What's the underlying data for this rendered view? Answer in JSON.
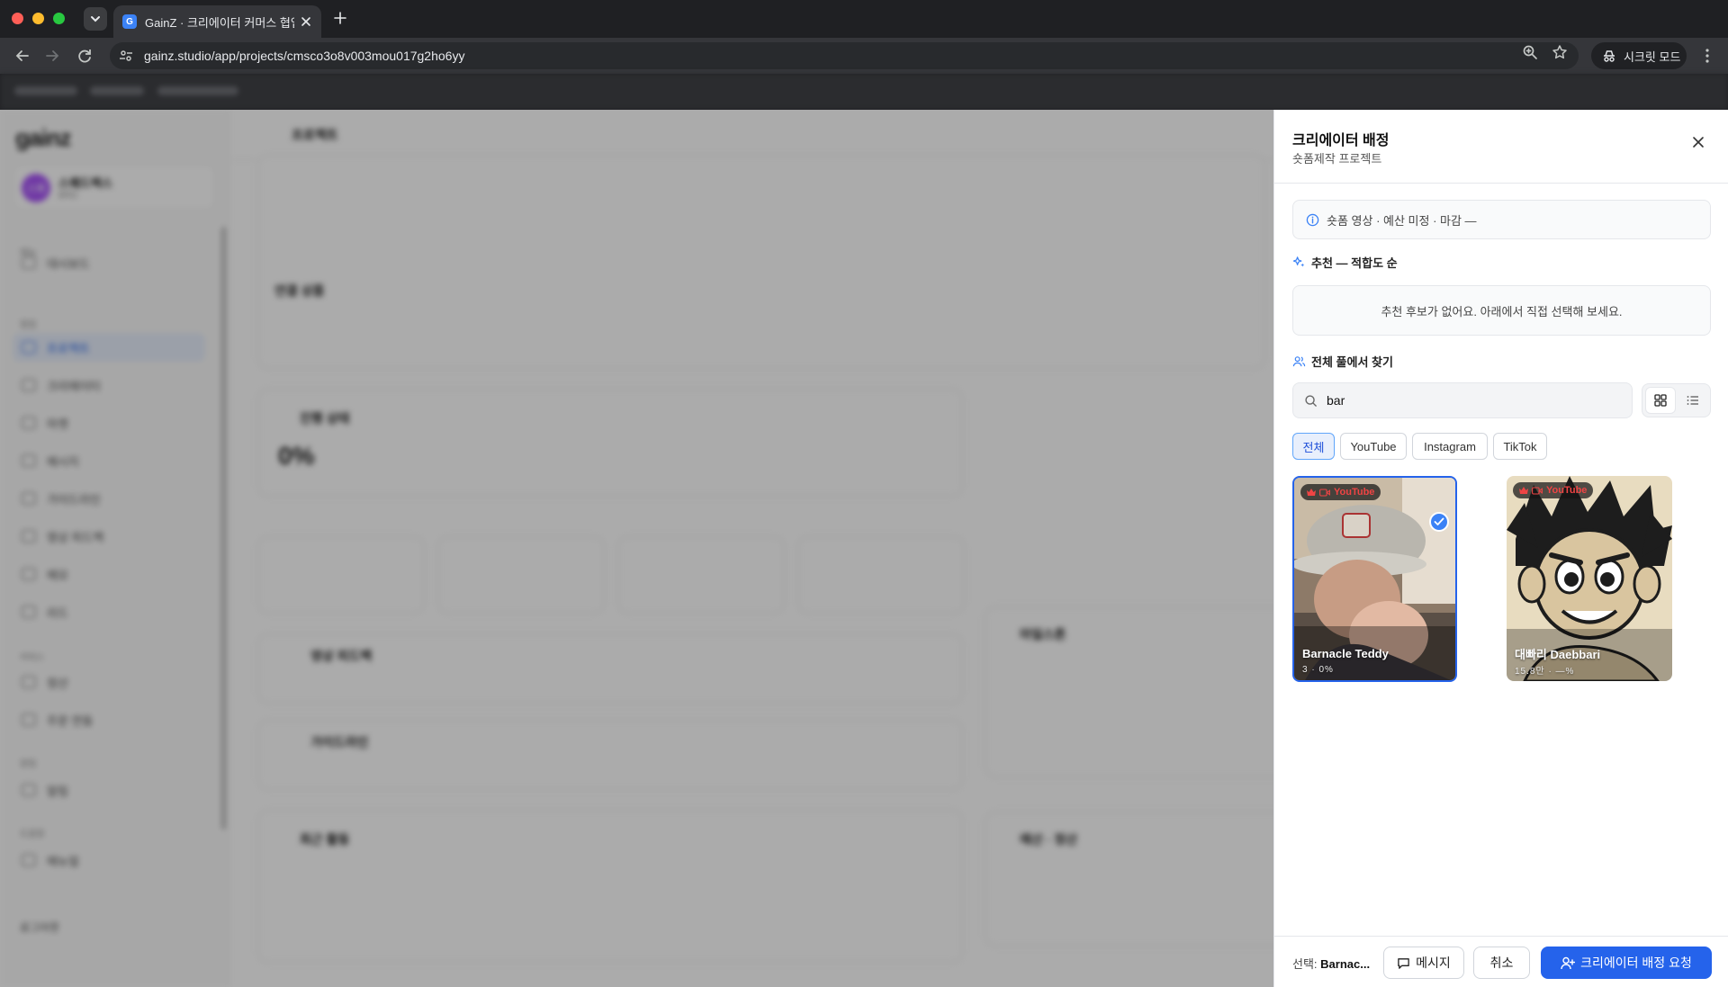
{
  "browser": {
    "tab_title": "GainZ · 크리에이터 커머스 협업 C",
    "favicon_letter": "G",
    "url": "gainz.studio/app/projects/cmsco3o8v003mou017g2ho6yy",
    "incognito_label": "시크릿 모드"
  },
  "app_bg": {
    "logo": "gainz",
    "workspace_initials": "스퀘",
    "workspace_name": "스퀘드렉스",
    "workspace_sub": "BRD",
    "topbar_title": "프로젝트",
    "sidebar_sections": [
      "메뉴",
      "협업",
      "커머스",
      "알림",
      "도움말"
    ],
    "sidebar_items": [
      "대시보드",
      "프로젝트",
      "크리에이터",
      "마켓",
      "메시지",
      "가이드라인",
      "영상 피드백",
      "메모",
      "리드",
      "정산",
      "주문 연동",
      "알림",
      "매뉴얼"
    ],
    "logout": "로그아웃",
    "progress_title": "진행 상태",
    "progress_value": "0%",
    "linked_title": "연결 상품",
    "feedback_title": "영상 피드백",
    "guide_title": "가이드라인",
    "recent_title": "최근 활동",
    "milestone_title": "마일스톤",
    "budget_title": "예산 · 정산"
  },
  "drawer": {
    "title": "크리에이터 배정",
    "subtitle": "숏폼제작 프로젝트",
    "info_text": "숏폼 영상 · 예산 미정 · 마감 —",
    "recommend_heading": "추천 — 적합도 순",
    "recommend_empty": "추천 후보가 없어요. 아래에서 직접 선택해 보세요.",
    "pool_heading": "전체 풀에서 찾기",
    "search_value": "bar",
    "filters": [
      "전체",
      "YouTube",
      "Instagram",
      "TikTok"
    ],
    "active_filter": "전체",
    "creators": [
      {
        "name": "Barnacle Teddy",
        "platform": "YouTube",
        "stats": "3 · 0%",
        "selected": true
      },
      {
        "name": "대빠리 Daebbari",
        "platform": "YouTube",
        "stats": "15.8만 · —%",
        "selected": false
      }
    ],
    "footer": {
      "selected_prefix": "선택:",
      "selected_name": "Barnac...",
      "message_button": "메시지",
      "cancel_button": "취소",
      "assign_button": "크리에이터 배정 요청"
    }
  },
  "colors": {
    "accent": "#2563eb",
    "youtube": "#ef4444",
    "overlay": "rgba(0,0,0,0.33)"
  }
}
